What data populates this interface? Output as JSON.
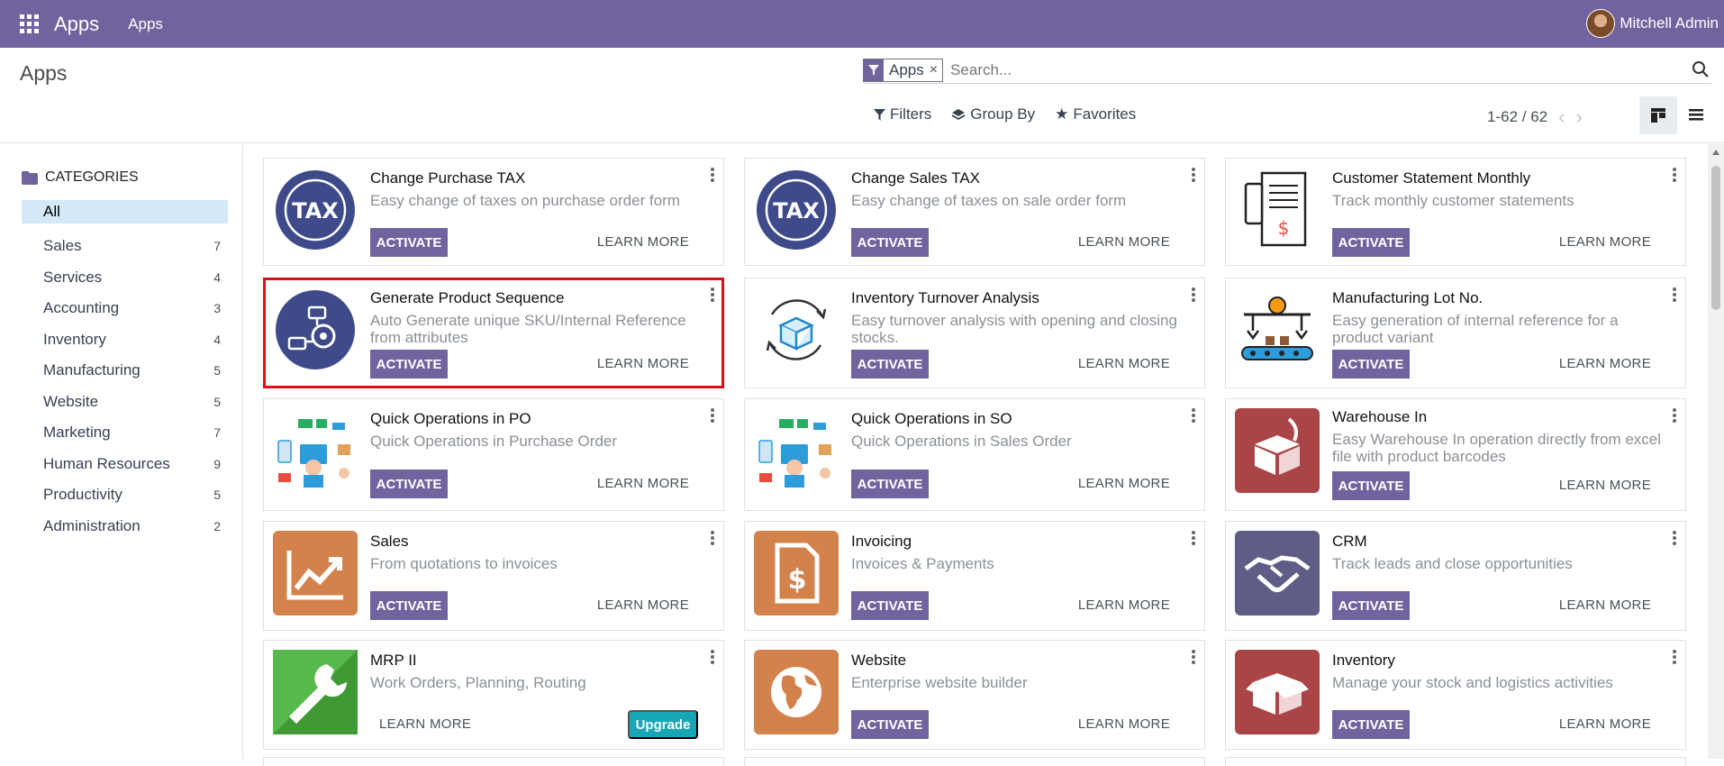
{
  "navbar": {
    "brand": "Apps",
    "menu": "Apps",
    "user": "Mitchell Admin"
  },
  "control": {
    "breadcrumb": "Apps",
    "facet": "Apps",
    "search_placeholder": "Search...",
    "filters": "Filters",
    "group_by": "Group By",
    "favorites": "Favorites",
    "pager": "1-62 / 62"
  },
  "sidebar": {
    "header": "CATEGORIES",
    "items": [
      {
        "label": "All",
        "count": ""
      },
      {
        "label": "Sales",
        "count": "7"
      },
      {
        "label": "Services",
        "count": "4"
      },
      {
        "label": "Accounting",
        "count": "3"
      },
      {
        "label": "Inventory",
        "count": "4"
      },
      {
        "label": "Manufacturing",
        "count": "5"
      },
      {
        "label": "Website",
        "count": "5"
      },
      {
        "label": "Marketing",
        "count": "7"
      },
      {
        "label": "Human Resources",
        "count": "9"
      },
      {
        "label": "Productivity",
        "count": "5"
      },
      {
        "label": "Administration",
        "count": "2"
      }
    ]
  },
  "cards": [
    {
      "title": "Change Purchase TAX",
      "sub": "Easy change of taxes on purchase order form",
      "activate": "ACTIVATE",
      "learn": "LEARN MORE"
    },
    {
      "title": "Change Sales TAX",
      "sub": "Easy change of taxes on sale order form",
      "activate": "ACTIVATE",
      "learn": "LEARN MORE"
    },
    {
      "title": "Customer Statement Monthly",
      "sub": "Track monthly customer statements",
      "activate": "ACTIVATE",
      "learn": "LEARN MORE"
    },
    {
      "title": "Generate Product Sequence",
      "sub": "Auto Generate unique SKU/Internal Reference from attributes",
      "activate": "ACTIVATE",
      "learn": "LEARN MORE"
    },
    {
      "title": "Inventory Turnover Analysis",
      "sub": "Easy turnover analysis with opening and closing stocks.",
      "activate": "ACTIVATE",
      "learn": "LEARN MORE"
    },
    {
      "title": "Manufacturing Lot No.",
      "sub": "Easy generation of internal reference for a product variant",
      "activate": "ACTIVATE",
      "learn": "LEARN MORE"
    },
    {
      "title": "Quick Operations in PO",
      "sub": "Quick Operations in Purchase Order",
      "activate": "ACTIVATE",
      "learn": "LEARN MORE"
    },
    {
      "title": "Quick Operations in SO",
      "sub": "Quick Operations in Sales Order",
      "activate": "ACTIVATE",
      "learn": "LEARN MORE"
    },
    {
      "title": "Warehouse In",
      "sub": "Easy Warehouse In operation directly from excel file with product barcodes",
      "activate": "ACTIVATE",
      "learn": "LEARN MORE"
    },
    {
      "title": "Sales",
      "sub": "From quotations to invoices",
      "activate": "ACTIVATE",
      "learn": "LEARN MORE"
    },
    {
      "title": "Invoicing",
      "sub": "Invoices & Payments",
      "activate": "ACTIVATE",
      "learn": "LEARN MORE"
    },
    {
      "title": "CRM",
      "sub": "Track leads and close opportunities",
      "activate": "ACTIVATE",
      "learn": "LEARN MORE"
    },
    {
      "title": "MRP II",
      "sub": "Work Orders, Planning, Routing",
      "learn": "LEARN MORE",
      "upgrade": "Upgrade"
    },
    {
      "title": "Website",
      "sub": "Enterprise website builder",
      "activate": "ACTIVATE",
      "learn": "LEARN MORE"
    },
    {
      "title": "Inventory",
      "sub": "Manage your stock and logistics activities",
      "activate": "ACTIVATE",
      "learn": "LEARN MORE"
    }
  ],
  "colors": {
    "brand": "#71639e",
    "highlight": "#e10d17",
    "upgrade": "#16a6b6"
  }
}
